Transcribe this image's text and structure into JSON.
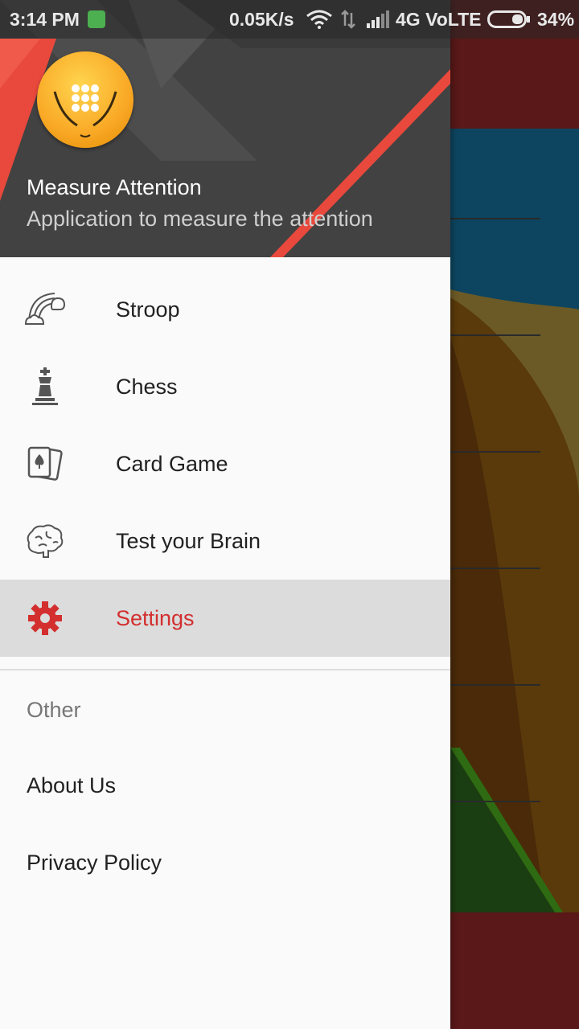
{
  "status_bar": {
    "time": "3:14 PM",
    "speed": "0.05K/s",
    "network": "4G VoLTE",
    "battery": "34%"
  },
  "drawer": {
    "header": {
      "title": "Measure Attention",
      "subtitle": "Application to measure the attention"
    },
    "items": [
      {
        "label": "Stroop",
        "icon": "rainbow-cloud-icon"
      },
      {
        "label": "Chess",
        "icon": "chess-king-icon"
      },
      {
        "label": "Card Game",
        "icon": "playing-cards-icon"
      },
      {
        "label": "Test your Brain",
        "icon": "brain-icon"
      },
      {
        "label": "Settings",
        "icon": "gear-icon",
        "selected": true
      }
    ],
    "section_label": "Other",
    "other_items": [
      {
        "label": "About Us"
      },
      {
        "label": "Privacy Policy"
      }
    ]
  },
  "colors": {
    "accent": "#d32f2f",
    "header_bg": "#424242",
    "selected_bg": "#dcdcdc"
  }
}
